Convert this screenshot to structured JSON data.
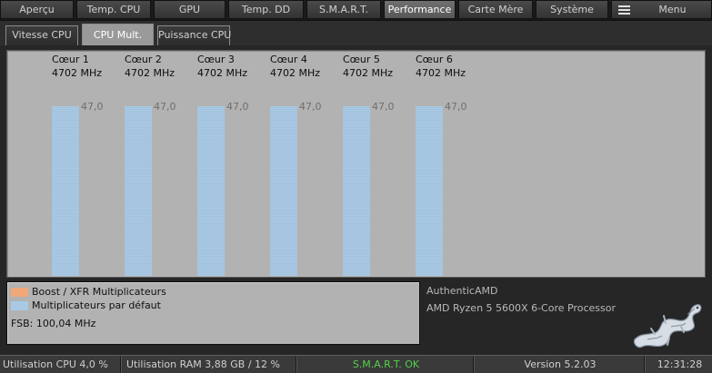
{
  "main_tabs": [
    "Aperçu",
    "Temp. CPU",
    "GPU",
    "Temp. DD",
    "S.M.A.R.T.",
    "Performance",
    "Carte Mère",
    "Système"
  ],
  "active_main_tab": "Performance",
  "menu_label": "Menu",
  "sub_tabs": [
    "Vitesse CPU",
    "CPU Mult.",
    "Puissance CPU"
  ],
  "active_sub_tab": "CPU Mult.",
  "chart_data": {
    "type": "bar",
    "categories": [
      "Cœur 1",
      "Cœur 2",
      "Cœur 3",
      "Cœur 4",
      "Cœur 5",
      "Cœur 6"
    ],
    "frequencies": [
      "4702 MHz",
      "4702 MHz",
      "4702 MHz",
      "4702 MHz",
      "4702 MHz",
      "4702 MHz"
    ],
    "series": [
      {
        "name": "Multiplicateurs par défaut",
        "values": [
          47.0,
          47.0,
          47.0,
          47.0,
          47.0,
          47.0
        ],
        "labels": [
          "47,0",
          "47,0",
          "47,0",
          "47,0",
          "47,0",
          "47,0"
        ],
        "color": "#a9c9e4"
      },
      {
        "name": "Boost / XFR Multiplicateurs",
        "values": [
          0,
          0,
          0,
          0,
          0,
          0
        ],
        "color": "#f0a878"
      }
    ]
  },
  "legend": [
    {
      "label": "Boost / XFR Multiplicateurs",
      "color": "#f0a878"
    },
    {
      "label": "Multiplicateurs par défaut",
      "color": "#a9c9e4"
    }
  ],
  "fsb": "FSB: 100,04 MHz",
  "cpu": {
    "vendor": "AuthenticAMD",
    "model": "AMD Ryzen 5 5600X 6-Core Processor"
  },
  "status_bar": {
    "cpu_usage": "Utilisation CPU 4,0 %",
    "ram_usage": "Utilisation RAM 3,88 GB / 12 %",
    "smart": "S.M.A.R.T. OK",
    "version": "Version 5.2.03",
    "time": "12:31:28"
  },
  "colors": {
    "smart_ok": "#53d14a",
    "panel_bg": "#b2b2b2"
  }
}
